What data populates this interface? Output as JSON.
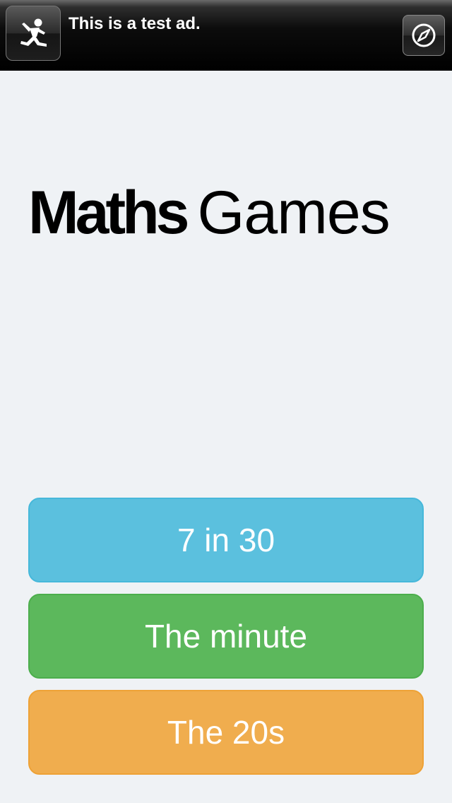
{
  "ad": {
    "text": "This is a test ad.",
    "icon": "running-person-icon",
    "action_icon": "compass-icon"
  },
  "logo": {
    "bold_part": "Maths",
    "light_part": "Games"
  },
  "menu": {
    "buttons": [
      {
        "label": "7 in 30",
        "color": "#5bc0de"
      },
      {
        "label": "The minute",
        "color": "#5cb85c"
      },
      {
        "label": "The 20s",
        "color": "#f0ad4e"
      }
    ]
  },
  "colors": {
    "background": "#eff2f5",
    "ad_background": "#000000"
  }
}
